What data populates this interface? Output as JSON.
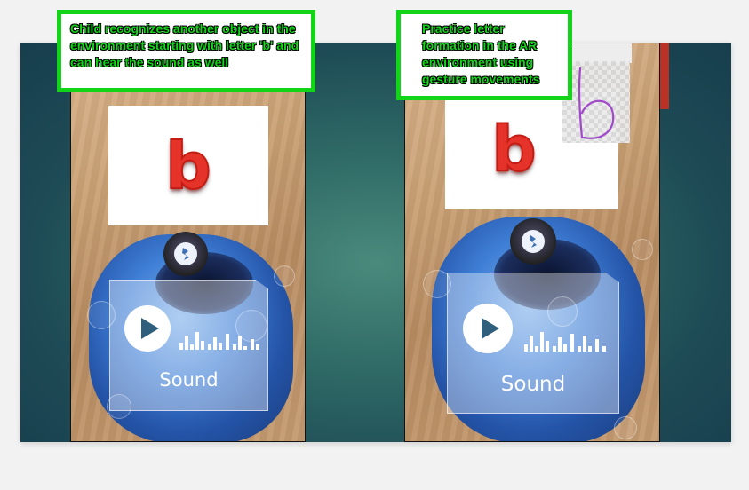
{
  "callouts": {
    "left": "Child recognizes another object in the environment starting with letter 'b' and can hear the sound as well",
    "right": "Practice letter formation in the AR environment using gesture movements"
  },
  "screens": {
    "left": {
      "letter": "b",
      "sound_label": "Sound",
      "marker_icon": "ar-marker-icon",
      "play_icon": "play-icon"
    },
    "right": {
      "letter": "b",
      "sound_label": "Sound",
      "marker_icon": "ar-marker-icon",
      "play_icon": "play-icon",
      "drawing_icon": "handwritten-b-icon"
    }
  },
  "colors": {
    "callout_border": "#12d418",
    "letter_red": "#e6332a",
    "slide_teal": "#2f6a66"
  }
}
